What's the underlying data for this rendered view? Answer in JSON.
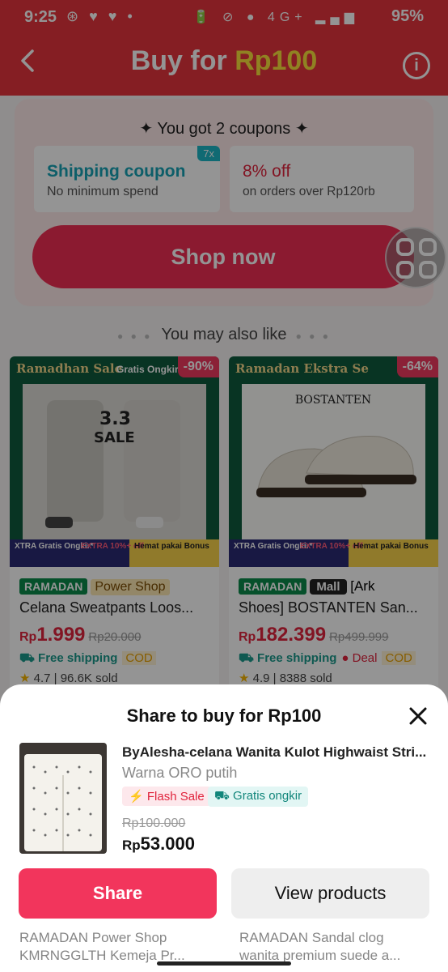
{
  "status_bar": {
    "time": "9:25",
    "left_icons": "⊛ ♥ ♥ •",
    "right_icons": "🔋 ⊘ ● 4G+ ▂▄▆",
    "battery": "95%"
  },
  "header": {
    "title_prefix": "Buy for ",
    "title_price": "Rp100"
  },
  "coupons": {
    "heading": "✦ You got 2 coupons ✦",
    "items": [
      {
        "title": "Shipping coupon",
        "subtitle": "No minimum spend",
        "count": "7x"
      },
      {
        "title": "8% off",
        "subtitle": "on orders over Rp120rb"
      }
    ],
    "cta": "Shop now"
  },
  "section_title": "You may also like",
  "products": [
    {
      "banner": "Ramadhan Sale",
      "banner_extra": "Gratis Ongkir",
      "discount": "-90%",
      "strip": {
        "a": "XTRA Gratis Ongkir*",
        "b": "EXTRA 10%+ off",
        "c": "Hemat pakai Bonus"
      },
      "tag_ramadan": "RAMADAN",
      "tag_shop": "Power Shop",
      "name": "Celana Sweatpants Loos...",
      "price_cur": "Rp",
      "price": "1.999",
      "old_price": "Rp20.000",
      "free_shipping": "Free shipping",
      "cod": "COD",
      "rating": "4.7",
      "sold": "96.6K sold"
    },
    {
      "banner": "Ramadan Ekstra Se",
      "discount": "-64%",
      "brand": "BOSTANTEN",
      "strip": {
        "a": "XTRA Gratis Ongkir*",
        "b": "EXTRA 10%+ off",
        "c": "Hemat pakai Bonus"
      },
      "tag_ramadan": "RAMADAN",
      "tag_mall": "Mall",
      "name_prefix": "[Ark",
      "name": "Shoes] BOSTANTEN San...",
      "price_cur": "Rp",
      "price": "182.399",
      "old_price": "Rp499.999",
      "free_shipping": "Free shipping",
      "deal": "Deal",
      "cod": "COD",
      "rating": "4.9",
      "sold": "8388 sold"
    }
  ],
  "sheet": {
    "title": "Share to buy for Rp100",
    "product_name": "ByAlesha-celana Wanita Kulot Highwaist Stri...",
    "variant": "Warna ORO putih",
    "flash_sale": "Flash Sale",
    "gratis_ongkir": "Gratis ongkir",
    "old_price": "Rp100.000",
    "price_cur": "Rp",
    "price": "53.000",
    "share_label": "Share",
    "view_label": "View products",
    "peek": {
      "left_tag": "RAMADAN",
      "left_shop": "Power Shop",
      "left_name": "KMRNGGLTH Kemeja Pr...",
      "right_tag": "RAMADAN",
      "right_name": "Sandal clog",
      "right_name2": "wanita premium suede a..."
    }
  }
}
